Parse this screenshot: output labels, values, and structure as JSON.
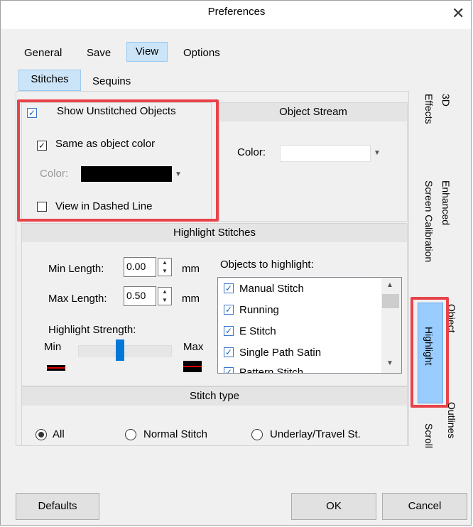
{
  "window": {
    "title": "Preferences"
  },
  "tabs": [
    "General",
    "Save",
    "View",
    "Options"
  ],
  "subtabs": [
    "Stitches",
    "Sequins"
  ],
  "unstitched": {
    "show_label": "Show Unstitched Objects",
    "same_color_label": "Same as object color",
    "color_label": "Color:",
    "color_value": "#000000",
    "dashed_label": "View in Dashed Line"
  },
  "object_stream": {
    "header": "Object Stream",
    "color_label": "Color:",
    "color_value": "#ffffff"
  },
  "highlight": {
    "header": "Highlight Stitches",
    "min_label": "Min Length:",
    "min_value": "0.00",
    "max_label": "Max Length:",
    "max_value": "0.50",
    "unit": "mm",
    "strength_label": "Highlight Strength:",
    "strength_min": "Min",
    "strength_max": "Max",
    "strength_level": 0.45,
    "objects_label": "Objects to highlight:",
    "objects": [
      "Manual Stitch",
      "Running",
      "E Stitch",
      "Single Path Satin",
      "Pattern Stitch"
    ]
  },
  "stitch_type": {
    "header": "Stitch type",
    "options": [
      "All",
      "Normal Stitch",
      "Underlay/Travel St."
    ],
    "selected": "All"
  },
  "side_tabs": [
    "3D Effects",
    "Enhanced Screen Calibration",
    "Object Highlight",
    "Outlines Scroll"
  ],
  "side_tab_parts": {
    "effects_a": "3D",
    "effects_b": "Effects",
    "screen_a": "Enhanced",
    "screen_b": "Screen Calibration",
    "object_a": "Object",
    "object_b": "Highlight",
    "outlines_a": "Outlines",
    "outlines_b": "Scroll"
  },
  "buttons": {
    "defaults": "Defaults",
    "ok": "OK",
    "cancel": "Cancel"
  },
  "colors": {
    "accent": "#cce4f7",
    "highlight_box": "#e8434a",
    "selected_side_tab": "#99ccff"
  }
}
